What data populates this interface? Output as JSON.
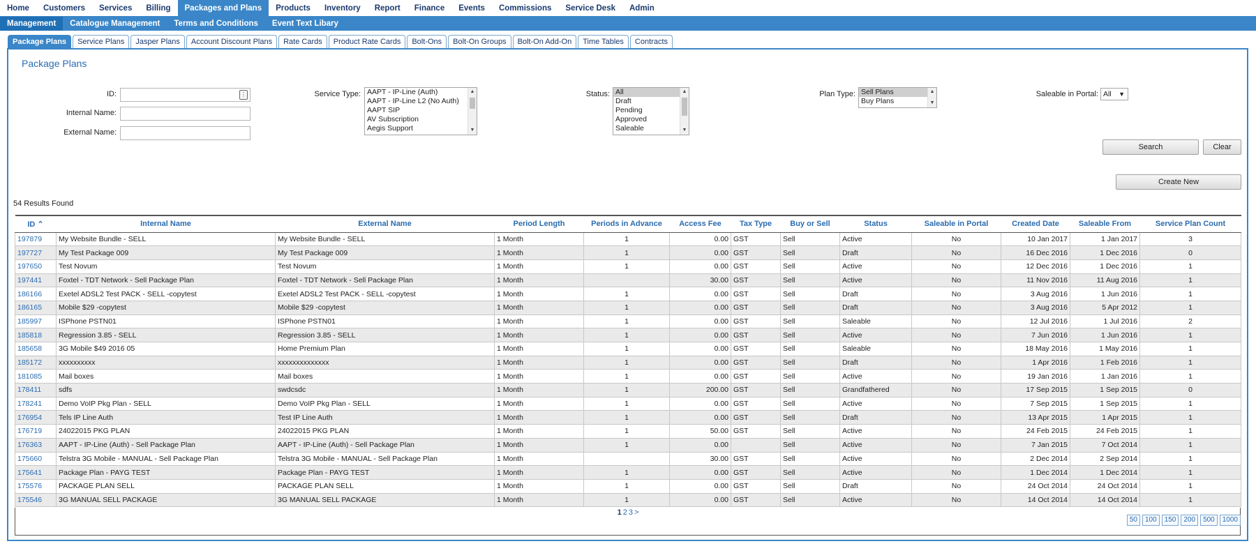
{
  "top_nav": [
    "Home",
    "Customers",
    "Services",
    "Billing",
    "Packages and Plans",
    "Products",
    "Inventory",
    "Report",
    "Finance",
    "Events",
    "Commissions",
    "Service Desk",
    "Admin"
  ],
  "top_nav_active": "Packages and Plans",
  "sub_nav": [
    "Management",
    "Catalogue Management",
    "Terms and Conditions",
    "Event Text Libary"
  ],
  "tabs": [
    "Package Plans",
    "Service Plans",
    "Jasper Plans",
    "Account Discount Plans",
    "Rate Cards",
    "Product Rate Cards",
    "Bolt-Ons",
    "Bolt-On Groups",
    "Bolt-On Add-On",
    "Time Tables",
    "Contracts"
  ],
  "panel_title": "Package Plans",
  "form": {
    "id_label": "ID:",
    "internal_name_label": "Internal Name:",
    "external_name_label": "External Name:",
    "service_type_label": "Service Type:",
    "service_type_options": [
      "AAPT - IP-Line (Auth)",
      "AAPT - IP-Line L2 (No Auth)",
      "AAPT SIP",
      "AV Subscription",
      "Aegis Support"
    ],
    "status_label": "Status:",
    "status_options": [
      "All",
      "Draft",
      "Pending",
      "Approved",
      "Saleable"
    ],
    "plan_type_label": "Plan Type:",
    "plan_type_options": [
      "Sell Plans",
      "Buy Plans"
    ],
    "saleable_label": "Saleable in Portal:",
    "saleable_value": "All",
    "search": "Search",
    "clear": "Clear",
    "create_new": "Create New"
  },
  "results_text": "54 Results Found",
  "table": {
    "headers": [
      "ID",
      "Internal Name",
      "External Name",
      "Period Length",
      "Periods in Advance",
      "Access Fee",
      "Tax Type",
      "Buy or Sell",
      "Status",
      "Saleable in Portal",
      "Created Date",
      "Saleable From",
      "Service Plan Count"
    ],
    "rows": [
      [
        "197879",
        "My Website Bundle - SELL",
        "My Website Bundle - SELL",
        "1 Month",
        "1",
        "0.00",
        "GST",
        "Sell",
        "Active",
        "No",
        "10 Jan 2017",
        "1 Jan 2017",
        "3"
      ],
      [
        "197727",
        "My Test Package 009",
        "My Test Package 009",
        "1 Month",
        "1",
        "0.00",
        "GST",
        "Sell",
        "Draft",
        "No",
        "16 Dec 2016",
        "1 Dec 2016",
        "0"
      ],
      [
        "197650",
        "Test Novum",
        "Test Novum",
        "1 Month",
        "1",
        "0.00",
        "GST",
        "Sell",
        "Active",
        "No",
        "12 Dec 2016",
        "1 Dec 2016",
        "1"
      ],
      [
        "197441",
        "Foxtel - TDT Network - Sell Package Plan",
        "Foxtel - TDT Network - Sell Package Plan",
        "1 Month",
        "",
        "30.00",
        "GST",
        "Sell",
        "Active",
        "No",
        "11 Nov 2016",
        "11 Aug 2016",
        "1"
      ],
      [
        "186166",
        "Exetel ADSL2 Test PACK - SELL -copytest",
        "Exetel ADSL2 Test PACK - SELL -copytest",
        "1 Month",
        "1",
        "0.00",
        "GST",
        "Sell",
        "Draft",
        "No",
        "3 Aug 2016",
        "1 Jun 2016",
        "1"
      ],
      [
        "186165",
        "Mobile $29 -copytest",
        "Mobile $29 -copytest",
        "1 Month",
        "1",
        "0.00",
        "GST",
        "Sell",
        "Draft",
        "No",
        "3 Aug 2016",
        "5 Apr 2012",
        "1"
      ],
      [
        "185997",
        "ISPhone PSTN01",
        "ISPhone PSTN01",
        "1 Month",
        "1",
        "0.00",
        "GST",
        "Sell",
        "Saleable",
        "No",
        "12 Jul 2016",
        "1 Jul 2016",
        "2"
      ],
      [
        "185818",
        "Regression 3.85 - SELL",
        "Regression 3.85 - SELL",
        "1 Month",
        "1",
        "0.00",
        "GST",
        "Sell",
        "Active",
        "No",
        "7 Jun 2016",
        "1 Jun 2016",
        "1"
      ],
      [
        "185658",
        "3G Mobile $49 2016 05",
        "Home Premium Plan",
        "1 Month",
        "1",
        "0.00",
        "GST",
        "Sell",
        "Saleable",
        "No",
        "18 May 2016",
        "1 May 2016",
        "1"
      ],
      [
        "185172",
        "xxxxxxxxxx",
        "xxxxxxxxxxxxxx",
        "1 Month",
        "1",
        "0.00",
        "GST",
        "Sell",
        "Draft",
        "No",
        "1 Apr 2016",
        "1 Feb 2016",
        "1"
      ],
      [
        "181085",
        "Mail boxes",
        "Mail boxes",
        "1 Month",
        "1",
        "0.00",
        "GST",
        "Sell",
        "Active",
        "No",
        "19 Jan 2016",
        "1 Jan 2016",
        "1"
      ],
      [
        "178411",
        "sdfs",
        "swdcsdc",
        "1 Month",
        "1",
        "200.00",
        "GST",
        "Sell",
        "Grandfathered",
        "No",
        "17 Sep 2015",
        "1 Sep 2015",
        "0"
      ],
      [
        "178241",
        "Demo VoIP Pkg Plan - SELL",
        "Demo VoIP Pkg Plan - SELL",
        "1 Month",
        "1",
        "0.00",
        "GST",
        "Sell",
        "Active",
        "No",
        "7 Sep 2015",
        "1 Sep 2015",
        "1"
      ],
      [
        "176954",
        "Tels IP Line Auth",
        "Test IP Line Auth",
        "1 Month",
        "1",
        "0.00",
        "GST",
        "Sell",
        "Draft",
        "No",
        "13 Apr 2015",
        "1 Apr 2015",
        "1"
      ],
      [
        "176719",
        "24022015 PKG PLAN",
        "24022015 PKG PLAN",
        "1 Month",
        "1",
        "50.00",
        "GST",
        "Sell",
        "Active",
        "No",
        "24 Feb 2015",
        "24 Feb 2015",
        "1"
      ],
      [
        "176363",
        "AAPT - IP-Line (Auth) - Sell Package Plan",
        "AAPT - IP-Line (Auth) - Sell Package Plan",
        "1 Month",
        "1",
        "0.00",
        "",
        "Sell",
        "Active",
        "No",
        "7 Jan 2015",
        "7 Oct 2014",
        "1"
      ],
      [
        "175660",
        "Telstra 3G Mobile - MANUAL - Sell Package Plan",
        "Telstra 3G Mobile - MANUAL - Sell Package Plan",
        "1 Month",
        "",
        "30.00",
        "GST",
        "Sell",
        "Active",
        "No",
        "2 Dec 2014",
        "2 Sep 2014",
        "1"
      ],
      [
        "175641",
        "Package Plan - PAYG TEST",
        "Package Plan - PAYG TEST",
        "1 Month",
        "1",
        "0.00",
        "GST",
        "Sell",
        "Active",
        "No",
        "1 Dec 2014",
        "1 Dec 2014",
        "1"
      ],
      [
        "175576",
        "PACKAGE PLAN SELL",
        "PACKAGE PLAN SELL",
        "1 Month",
        "1",
        "0.00",
        "GST",
        "Sell",
        "Draft",
        "No",
        "24 Oct 2014",
        "24 Oct 2014",
        "1"
      ],
      [
        "175546",
        "3G MANUAL SELL PACKAGE",
        "3G MANUAL SELL PACKAGE",
        "1 Month",
        "1",
        "0.00",
        "GST",
        "Sell",
        "Active",
        "No",
        "14 Oct 2014",
        "14 Oct 2014",
        "1"
      ]
    ]
  },
  "pager": {
    "pages": [
      "1",
      "2",
      "3",
      ">"
    ],
    "current": "1"
  },
  "page_sizes": [
    "50",
    "100",
    "150",
    "200",
    "500",
    "1000"
  ],
  "colors": {
    "accent": "#3a86c8",
    "link": "#2b6cb0"
  }
}
